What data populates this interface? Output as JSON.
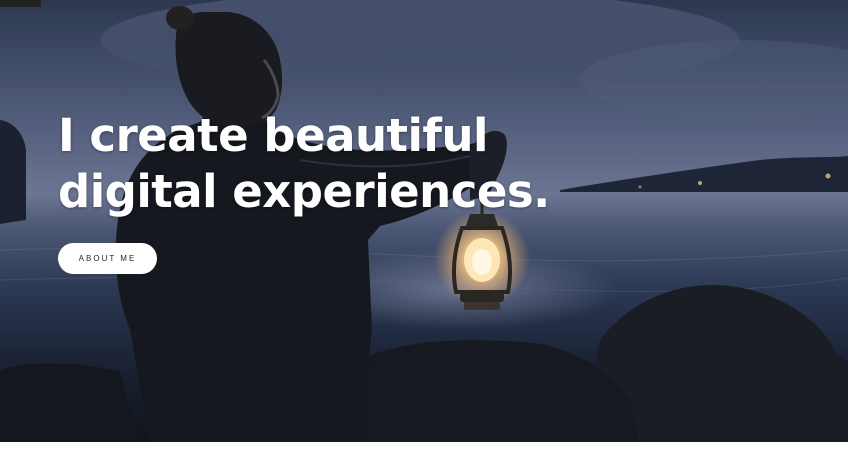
{
  "hero": {
    "headline_line1": "I create beautiful",
    "headline_line2": "digital experiences.",
    "button_label": "ABOUT ME",
    "background_image": "man-holding-lantern-by-sea-at-dusk"
  },
  "colors": {
    "headline_text": "#ffffff",
    "button_bg": "#ffffff",
    "button_text": "#2a2a2a",
    "sky": "#6c7592",
    "water": "#2b3852",
    "lantern_glow": "#ffd9a0"
  }
}
